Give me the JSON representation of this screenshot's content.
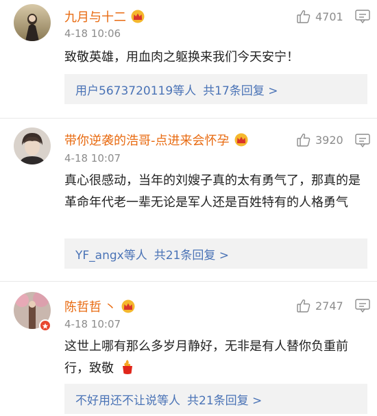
{
  "comments": [
    {
      "user": "九月与十二",
      "rank": "",
      "time": "4-18 10:06",
      "text": "致敬英雄，用血肉之躯换来我们今天安宁！",
      "likes": "4701",
      "replies_users": "用户5673720119等人",
      "replies_count": "共17条回复 >"
    },
    {
      "user": "带你逆袭的浩哥-点进来会怀孕",
      "rank": "",
      "time": "4-18 10:07",
      "text": "真心很感动，当年的刘嫂子真的太有勇气了，那真的是革命年代老一辈无论是军人还是百姓特有的人格勇气",
      "likes": "3920",
      "replies_users": "YF_angx等人",
      "replies_count": "共21条回复 >"
    },
    {
      "user": "陈哲哲",
      "rank": "丶",
      "time": "4-18 10:07",
      "text": "这世上哪有那么多岁月静好，无非是有人替你负重前行，致敬",
      "likes": "2747",
      "replies_users": "不好用还不让说等人",
      "replies_count": "共21条回复 >"
    }
  ],
  "icons": {
    "like": "thumb-up-icon",
    "more": "comment-more-icon",
    "crown": "vip-crown-icon",
    "emoji": "fire-cup-emoji"
  },
  "colors": {
    "username": "#e86a10",
    "link": "#4a73b6",
    "reply_bg": "#f2f2f2"
  }
}
